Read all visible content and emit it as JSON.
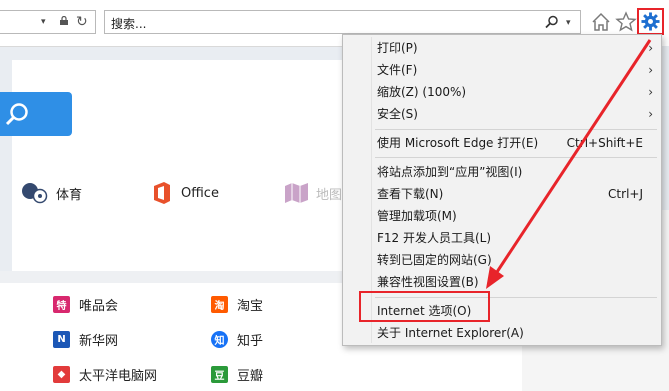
{
  "toolbar": {
    "search_placeholder": "搜索...",
    "addr_dropdown": "▾",
    "refresh_glyph": "↻",
    "search_dropdown": "▾"
  },
  "quick_links": [
    {
      "label": "体育"
    },
    {
      "label": "Office"
    },
    {
      "label": "地图"
    }
  ],
  "sites": [
    {
      "label": "唯品会",
      "icon": "vip-icon",
      "glyph": "特",
      "color": "#d8286e"
    },
    {
      "label": "淘宝",
      "icon": "taobao-icon",
      "glyph": "淘",
      "color": "#ff5a00"
    },
    {
      "label": "新华网",
      "icon": "xinhua-icon",
      "glyph": "N",
      "color": "#1b57b6"
    },
    {
      "label": "知乎",
      "icon": "zhihu-icon",
      "glyph": "知",
      "color": "#1772f6"
    },
    {
      "label": "太平洋电脑网",
      "icon": "pconline-icon",
      "glyph": "◆",
      "color": "#e23b3b"
    },
    {
      "label": "豆瓣",
      "icon": "douban-icon",
      "glyph": "豆",
      "color": "#2b9a3a"
    }
  ],
  "menu": {
    "items": [
      {
        "label": "打印(P)",
        "shortcut": "",
        "submenu": true
      },
      {
        "label": "文件(F)",
        "shortcut": "",
        "submenu": true
      },
      {
        "label": "缩放(Z) (100%)",
        "shortcut": "",
        "submenu": true
      },
      {
        "label": "安全(S)",
        "shortcut": "",
        "submenu": true
      },
      {
        "label": "使用 Microsoft Edge 打开(E)",
        "shortcut": "Ctrl+Shift+E",
        "submenu": false
      },
      {
        "label": "将站点添加到“应用”视图(I)",
        "shortcut": "",
        "submenu": false
      },
      {
        "label": "查看下载(N)",
        "shortcut": "Ctrl+J",
        "submenu": false
      },
      {
        "label": "管理加载项(M)",
        "shortcut": "",
        "submenu": false
      },
      {
        "label": "F12 开发人员工具(L)",
        "shortcut": "",
        "submenu": false
      },
      {
        "label": "转到已固定的网站(G)",
        "shortcut": "",
        "submenu": false
      },
      {
        "label": "兼容性视图设置(B)",
        "shortcut": "",
        "submenu": false
      },
      {
        "label": "Internet 选项(O)",
        "shortcut": "",
        "submenu": false
      },
      {
        "label": "关于 Internet Explorer(A)",
        "shortcut": "",
        "submenu": false
      }
    ],
    "arrow_glyph": "›"
  },
  "colors": {
    "annotation_red": "#e8242a",
    "accent_blue": "#2f8fe6"
  }
}
